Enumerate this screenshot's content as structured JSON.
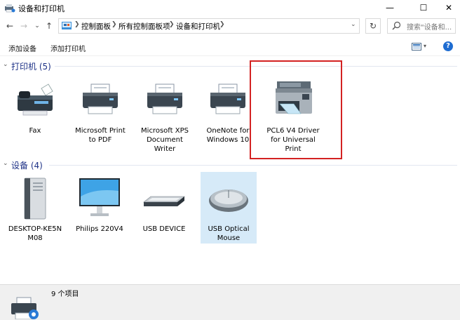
{
  "window": {
    "title": "设备和打印机",
    "minimize": "—",
    "maximize": "☐",
    "close": "✕"
  },
  "nav": {
    "back": "←",
    "forward": "→",
    "recent": "⌄",
    "up": "↑",
    "breadcrumbs": [
      "控制面板",
      "所有控制面板项",
      "设备和打印机"
    ],
    "refresh": "↻",
    "search_placeholder": "搜索\"设备和..."
  },
  "toolbar": {
    "add_device": "添加设备",
    "add_printer": "添加打印机",
    "help": "?"
  },
  "printers": {
    "header": "打印机 (5)",
    "items": [
      {
        "label": "Fax",
        "icon": "fax-icon"
      },
      {
        "label": "Microsoft Print to PDF",
        "icon": "printer-icon"
      },
      {
        "label": "Microsoft XPS Document Writer",
        "icon": "printer-icon"
      },
      {
        "label": "OneNote for Windows 10",
        "icon": "printer-icon"
      },
      {
        "label": "PCL6 V4 Driver for Universal Print",
        "icon": "inkjet-printer-icon"
      }
    ]
  },
  "devices": {
    "header": "设备 (4)",
    "items": [
      {
        "label": "DESKTOP-KE5N M08",
        "icon": "computer-tower-icon"
      },
      {
        "label": "Philips 220V4",
        "icon": "monitor-icon"
      },
      {
        "label": "USB DEVICE",
        "icon": "keyboard-icon"
      },
      {
        "label": "USB Optical Mouse",
        "icon": "mouse-icon"
      }
    ]
  },
  "status": {
    "count": "9 个项目"
  },
  "colors": {
    "group_header": "#1e3287",
    "highlight": "#d32222",
    "selection": "#d6eaf8"
  }
}
